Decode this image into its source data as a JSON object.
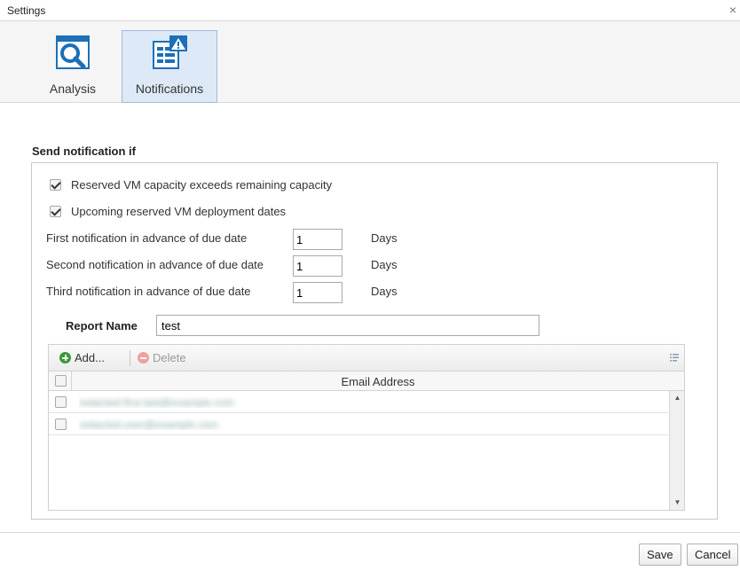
{
  "window": {
    "title": "Settings",
    "close_glyph": "×"
  },
  "toolbar": {
    "items": [
      {
        "label": "Analysis",
        "icon": "analysis-magnifier-icon",
        "active": false
      },
      {
        "label": "Notifications",
        "icon": "notifications-alert-icon",
        "active": true
      }
    ]
  },
  "form": {
    "section_title": "Send notification if",
    "checks": [
      {
        "label": "Reserved VM capacity exceeds remaining capacity",
        "checked": true
      },
      {
        "label": "Upcoming reserved VM deployment dates",
        "checked": true
      }
    ],
    "notifications": [
      {
        "label": "First notification in advance of due date",
        "value": "1",
        "unit": "Days"
      },
      {
        "label": "Second notification in advance of due date",
        "value": "1",
        "unit": "Days"
      },
      {
        "label": "Third notification in advance of due date",
        "value": "1",
        "unit": "Days"
      }
    ],
    "report_name_label": "Report Name",
    "report_name_value": "test"
  },
  "grid": {
    "add_label": "Add...",
    "delete_label": "Delete",
    "column_header": "Email Address",
    "rows": [
      {
        "email": "redacted.first.last@example.com"
      },
      {
        "email": "redacted.user@example.com"
      }
    ]
  },
  "footer": {
    "save_label": "Save",
    "cancel_label": "Cancel"
  },
  "colors": {
    "active_tab_bg": "#dde9f6",
    "icon_blue": "#1d6fb8",
    "add_green": "#3a9a3a"
  }
}
